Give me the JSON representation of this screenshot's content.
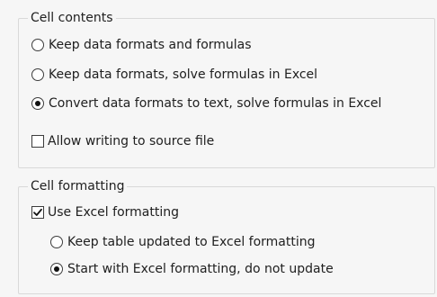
{
  "cell_contents": {
    "title": "Cell contents",
    "options": [
      {
        "label": "Keep data formats and formulas",
        "checked": false
      },
      {
        "label": "Keep data formats, solve formulas in Excel",
        "checked": false
      },
      {
        "label": "Convert data formats to text, solve formulas in Excel",
        "checked": true
      }
    ],
    "allow_writing": {
      "label": "Allow writing to source file",
      "checked": false
    }
  },
  "cell_formatting": {
    "title": "Cell formatting",
    "use_excel": {
      "label": "Use Excel formatting",
      "checked": true
    },
    "options": [
      {
        "label": "Keep table updated to Excel formatting",
        "checked": false
      },
      {
        "label": "Start with Excel formatting, do not update",
        "checked": true
      }
    ]
  }
}
